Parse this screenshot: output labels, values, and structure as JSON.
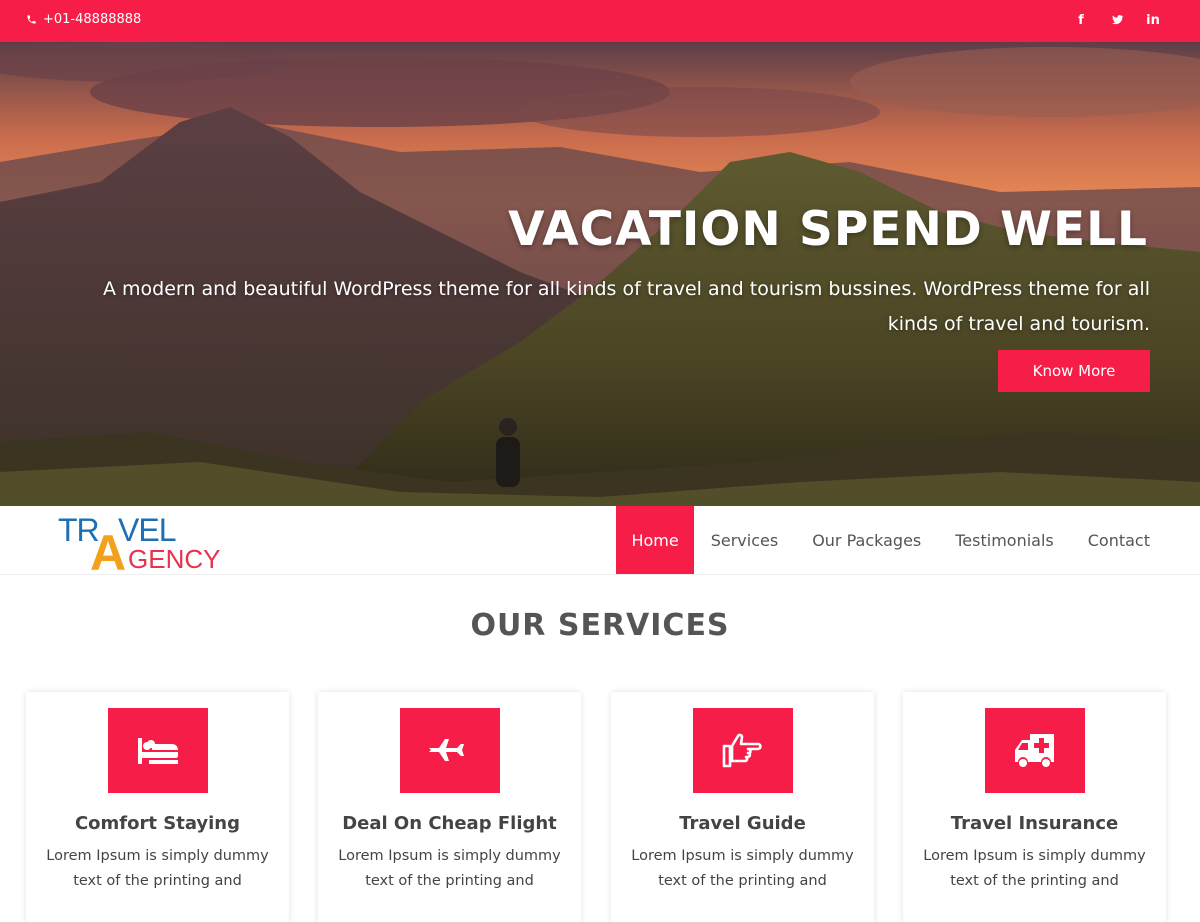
{
  "topbar": {
    "phone": "+01-48888888",
    "social": [
      {
        "icon": "facebook-icon",
        "glyph": "f"
      },
      {
        "icon": "twitter-icon",
        "glyph": "t"
      },
      {
        "icon": "linkedin-icon",
        "glyph": "in"
      }
    ]
  },
  "hero": {
    "title": "VACATION SPEND WELL",
    "description": "A modern and beautiful WordPress theme for all kinds of travel and tourism bussines. WordPress theme for all kinds of travel and tourism.",
    "button_label": "Know More"
  },
  "logo": {
    "line1": "TRAVEL",
    "line2": "AGENCY"
  },
  "nav": {
    "items": [
      "Home",
      "Services",
      "Our Packages",
      "Testimonials",
      "Contact"
    ],
    "active": "Home"
  },
  "services": {
    "title": "OUR SERVICES",
    "cards": [
      {
        "title": "Comfort Staying",
        "icon": "bed-icon",
        "text": "Lorem Ipsum is simply dummy text of the printing and"
      },
      {
        "title": "Deal On Cheap Flight",
        "icon": "airplane-icon",
        "text": "Lorem Ipsum is simply dummy text of the printing and"
      },
      {
        "title": "Travel Guide",
        "icon": "hand-pointer-icon",
        "text": "Lorem Ipsum is simply dummy text of the printing and"
      },
      {
        "title": "Travel Insurance",
        "icon": "ambulance-icon",
        "text": "Lorem Ipsum is simply dummy text of the printing and"
      }
    ]
  },
  "colors": {
    "accent": "#f61e48"
  }
}
